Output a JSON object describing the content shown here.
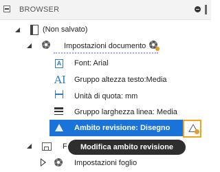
{
  "header": {
    "title": "BROWSER"
  },
  "tree": {
    "root": {
      "label": "(Non salvato)"
    },
    "doc_settings": {
      "label": "Impostazioni documento",
      "items": [
        {
          "label": "Font: Arial",
          "icon": "font-icon"
        },
        {
          "label": "Gruppo altezza testo:Media",
          "icon": "text-height-icon"
        },
        {
          "label": "Unità di quota: mm",
          "icon": "dimension-unit-icon"
        },
        {
          "label": "Gruppo larghezza linea: Media",
          "icon": "line-weight-icon"
        },
        {
          "label": "Ambito revisione: Disegno",
          "icon": "warning-icon",
          "selected": true
        }
      ]
    },
    "sheet": {
      "label": "F"
    },
    "sheet_settings": {
      "label": "Impostazioni foglio"
    }
  },
  "tooltip": {
    "text": "Modifica ambito revisione"
  },
  "colors": {
    "selection": "#1a73d9",
    "highlight_border": "#f3a21b",
    "tooltip_bg": "#2e2e2e",
    "icon_blue": "#2e7bc4"
  }
}
